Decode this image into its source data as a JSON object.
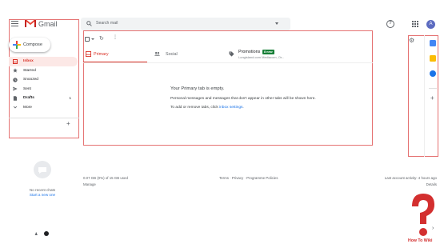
{
  "app": {
    "name": "Gmail",
    "avatar_letter": "A"
  },
  "search": {
    "placeholder": "Search mail"
  },
  "colors": {
    "accent_red": "#d93025",
    "highlight_box": "#e57373",
    "link_blue": "#1a73e8",
    "promo_badge": "#188038"
  },
  "sidebar": {
    "compose_label": "Compose",
    "items": [
      {
        "label": "Inbox",
        "icon": "inbox-icon",
        "active": true
      },
      {
        "label": "Starred",
        "icon": "star-icon"
      },
      {
        "label": "Snoozed",
        "icon": "clock-icon"
      },
      {
        "label": "Sent",
        "icon": "send-icon"
      },
      {
        "label": "Drafts",
        "icon": "draft-icon",
        "count": "1",
        "bold": true
      },
      {
        "label": "More",
        "icon": "chevron-down-icon"
      }
    ]
  },
  "chat": {
    "no_chats": "No recent chats",
    "start_new": "Start a new one"
  },
  "tabs": [
    {
      "label": "Primary",
      "icon": "inbox-icon"
    },
    {
      "label": "Social",
      "icon": "people-icon"
    }
  ],
  "promotions": {
    "label": "Promotions",
    "badge": "8 new",
    "preview": "Longisland.com Mediacom, Or..."
  },
  "empty_state": {
    "title": "Your Primary tab is empty.",
    "line1": "Personal messages and messages that don't appear in other tabs will be shown here.",
    "line2_prefix": "To add or remove tabs, click ",
    "line2_link": "inbox settings",
    "line2_suffix": "."
  },
  "footer": {
    "storage": "0.07 GB (0%) of 15 GB used",
    "manage": "Manage",
    "links": "Terms · Privacy · Programme Policies",
    "activity": "Last account activity: 4 hours ago",
    "details": "Details"
  },
  "watermark": {
    "text": "How To Wiki"
  }
}
